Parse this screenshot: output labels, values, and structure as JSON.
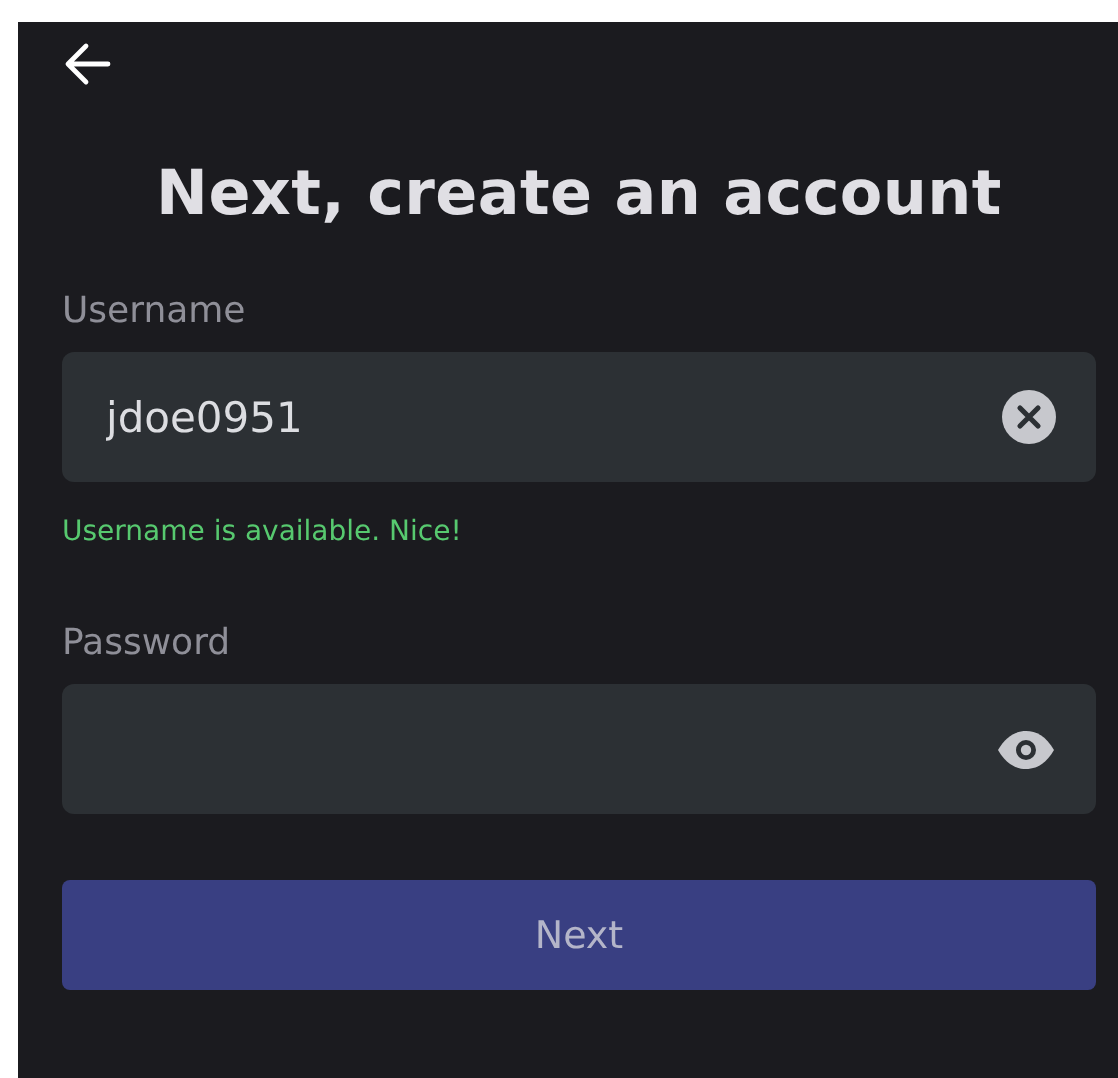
{
  "title": "Next, create an account",
  "username": {
    "label": "Username",
    "value": "jdoe0951"
  },
  "username_status": "Username is available. Nice!",
  "password": {
    "label": "Password"
  },
  "next_button": {
    "label": "Next",
    "disabled": true
  }
}
